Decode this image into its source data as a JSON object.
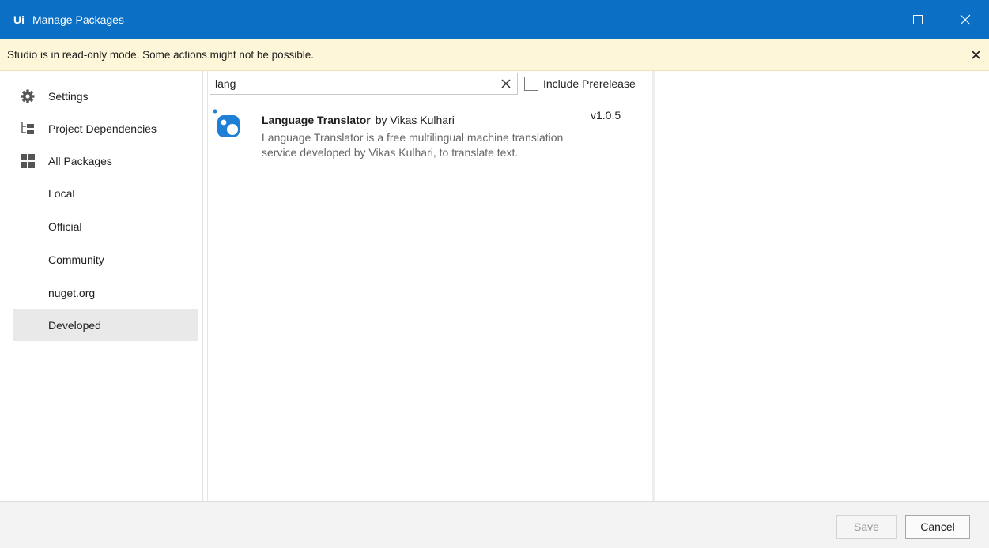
{
  "window": {
    "logo": "Ui",
    "title": "Manage Packages"
  },
  "banner": {
    "message": "Studio is in read-only mode. Some actions might not be possible."
  },
  "sidebar": {
    "items": [
      {
        "label": "Settings",
        "icon": "gear-icon"
      },
      {
        "label": "Project Dependencies",
        "icon": "dependency-tree-icon"
      },
      {
        "label": "All Packages",
        "icon": "grid-icon"
      },
      {
        "label": "Local"
      },
      {
        "label": "Official"
      },
      {
        "label": "Community"
      },
      {
        "label": "nuget.org"
      },
      {
        "label": "Developed",
        "selected": true
      }
    ]
  },
  "search": {
    "value": "lang",
    "include_prerelease_label": "Include Prerelease",
    "include_prerelease_checked": false
  },
  "packages": [
    {
      "name": "Language Translator",
      "by": "by  Vikas Kulhari",
      "version": "v1.0.5",
      "description": "Language Translator is a free multilingual machine translation service developed by Vikas Kulhari, to translate text."
    }
  ],
  "footer": {
    "save_label": "Save",
    "cancel_label": "Cancel"
  },
  "colors": {
    "titlebar": "#0a6fc5",
    "banner": "#fdf6d8",
    "selected": "#e9e9e9",
    "package_icon": "#1f7fd6"
  }
}
